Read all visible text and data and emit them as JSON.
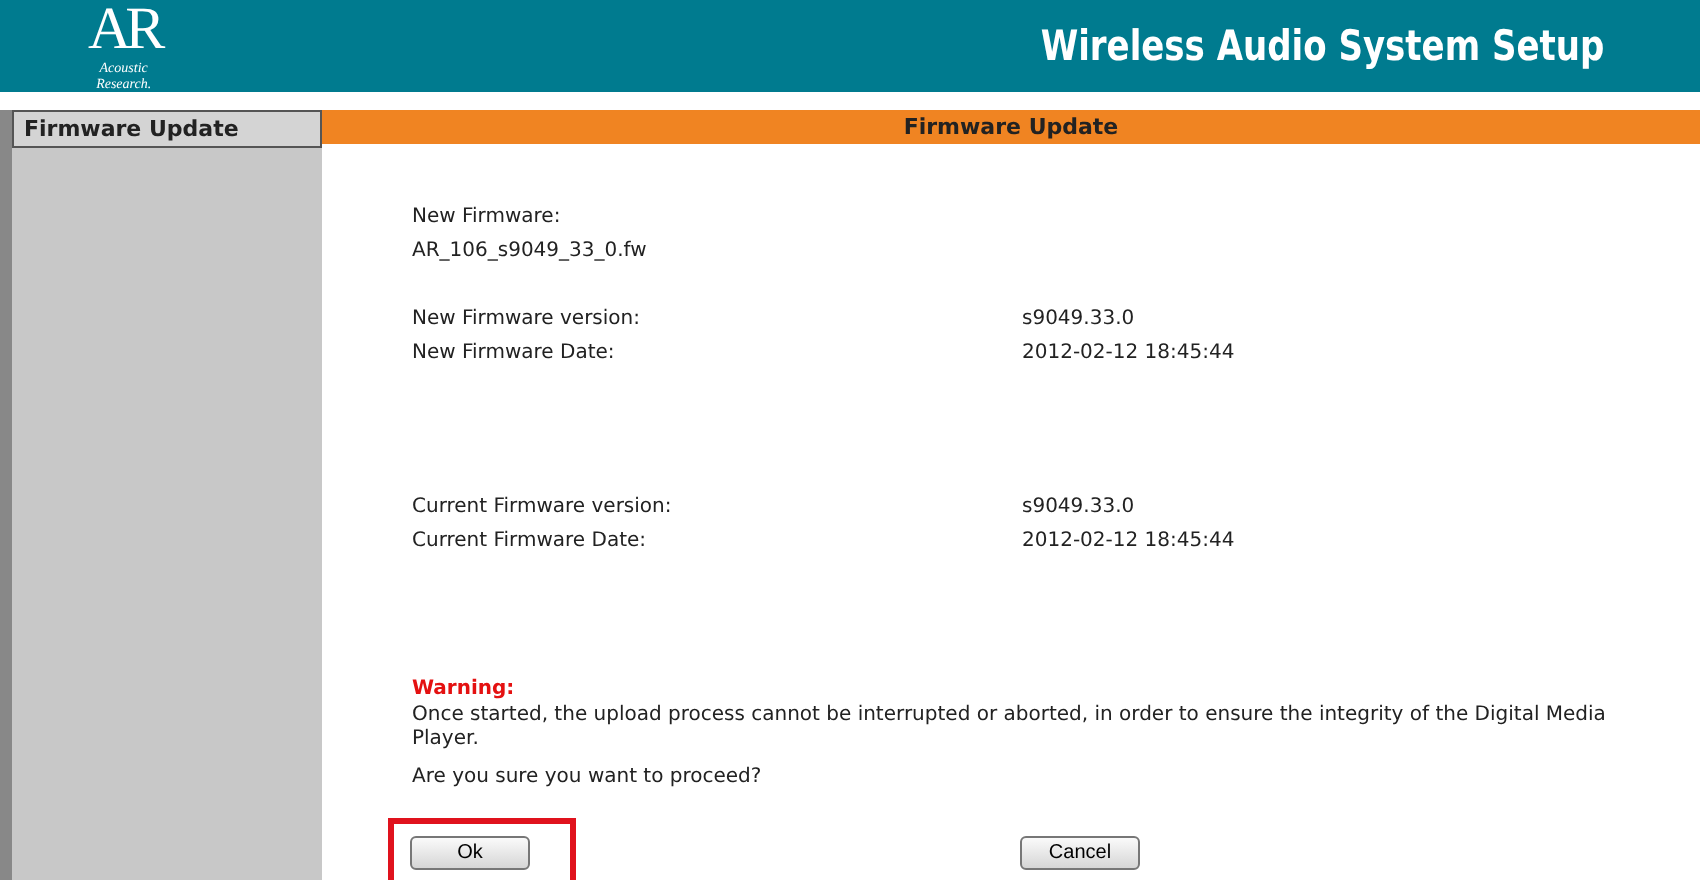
{
  "header": {
    "logo_mark": "AR",
    "logo_text_1": "Acoustic",
    "logo_text_2": "Research.",
    "title": "Wireless Audio System Setup"
  },
  "sidebar": {
    "items": [
      {
        "label": "Firmware Update",
        "selected": true
      }
    ]
  },
  "panel": {
    "title": "Firmware Update",
    "new_firmware_label": "New Firmware:",
    "new_firmware_file": "AR_106_s9049_33_0.fw",
    "new_rows": [
      {
        "label": "New Firmware version:",
        "value": "s9049.33.0"
      },
      {
        "label": "New Firmware Date:",
        "value": "2012-02-12  18:45:44"
      }
    ],
    "current_rows": [
      {
        "label": "Current Firmware version:",
        "value": "s9049.33.0"
      },
      {
        "label": "Current Firmware Date:",
        "value": "2012-02-12  18:45:44"
      }
    ],
    "warning_title": "Warning:",
    "warning_text": "Once started, the upload process cannot be interrupted or aborted, in order to ensure the integrity of the Digital Media Player.",
    "question": "Are you sure you want to proceed?",
    "buttons": [
      {
        "label": "Ok",
        "highlighted": true
      },
      {
        "label": "Cancel",
        "highlighted": false
      }
    ]
  }
}
